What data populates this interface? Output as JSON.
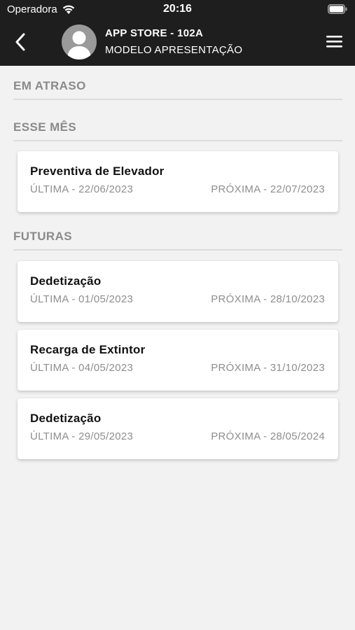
{
  "status_bar": {
    "carrier": "Operadora",
    "time": "20:16",
    "icons": [
      "wifi-icon",
      "battery-icon"
    ]
  },
  "header": {
    "back_icon": "chevron-left-icon",
    "avatar_icon": "user-silhouette-icon",
    "title": "APP STORE - 102A",
    "subtitle": "MODELO APRESENTAÇÃO",
    "menu_icon": "hamburger-menu-icon"
  },
  "sections": {
    "overdue": {
      "title": "EM ATRASO",
      "items": []
    },
    "this_month": {
      "title": "ESSE MÊS",
      "items": [
        {
          "title": "Preventiva de Elevador",
          "last": "ÚLTIMA - 22/06/2023",
          "next": "PRÓXIMA - 22/07/2023"
        }
      ]
    },
    "future": {
      "title": "FUTURAS",
      "items": [
        {
          "title": "Dedetização",
          "last": "ÚLTIMA - 01/05/2023",
          "next": "PRÓXIMA - 28/10/2023"
        },
        {
          "title": "Recarga de Extintor",
          "last": "ÚLTIMA - 04/05/2023",
          "next": "PRÓXIMA - 31/10/2023"
        },
        {
          "title": "Dedetização",
          "last": "ÚLTIMA - 29/05/2023",
          "next": "PRÓXIMA - 28/05/2024"
        }
      ]
    }
  },
  "colors": {
    "header_bg": "#1e1e1e",
    "page_bg": "#f2f2f2",
    "section_text": "#8a8a8a",
    "card_bg": "#ffffff",
    "date_text": "#8e8e8e"
  }
}
